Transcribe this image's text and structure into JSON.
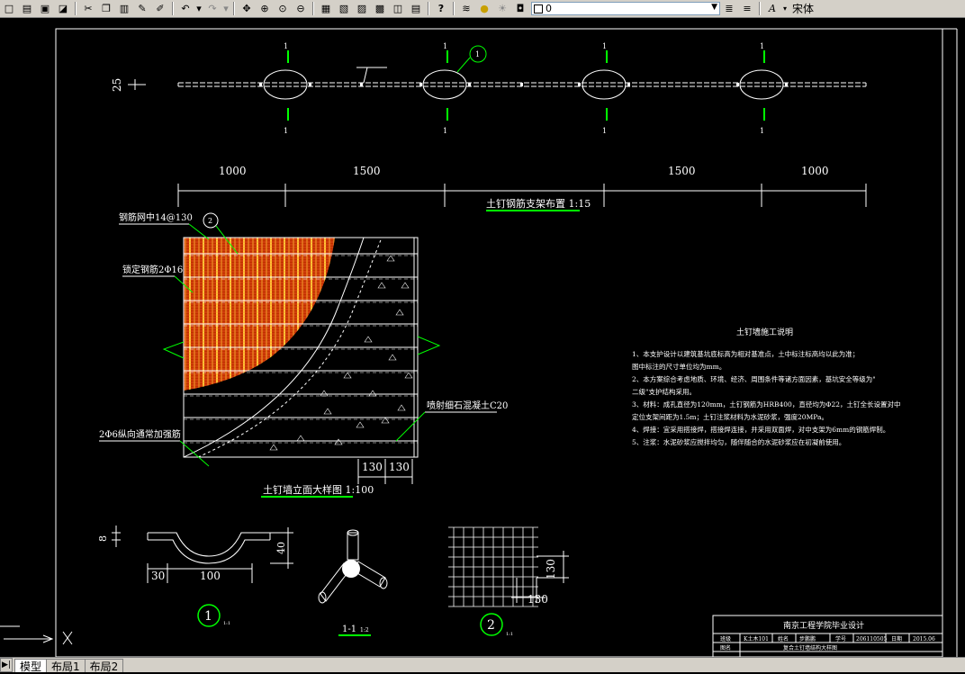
{
  "toolbar": {
    "layer_value": "0",
    "font_name": "宋体"
  },
  "drawing": {
    "plan": {
      "section_marks": [
        "1",
        "1",
        "1",
        "1",
        "1",
        "1",
        "1",
        "1"
      ],
      "detail_callout": "1",
      "left_dim": "25",
      "dims_left": [
        "1000",
        "1500"
      ],
      "dims_right": [
        "1500",
        "1000"
      ],
      "title": "土钉钢筋支架布置 1:15"
    },
    "elevation": {
      "label_mesh": "钢筋网中14@130",
      "label_fixed": "锁定钢筋2Φ16",
      "label_long": "2Φ6纵向通常加强筋",
      "label_shotcrete": "喷射细石混凝土C20",
      "detail_callout": "2",
      "dim_a": "130",
      "dim_b": "130",
      "title": "土钉墙立面大样图 1:100"
    },
    "notes": {
      "title": "土钉墙施工说明",
      "lines": [
        "1、本支护设计以建筑基坑底标高为相对基准点，土中标注标高均以此为准；",
        "图中标注的尺寸单位均为mm。",
        "2、本方案综合考虑地质、环境、经济、周围条件等诸方面因素，基坑安全等级为\"",
        "二级\"支护结构采用。",
        "3、材料：成孔直径为120mm，土钉钢筋为HRB400，直径均为Φ22，土钉全长设置对中",
        "定位支架间距为1.5m；土钉注浆材料为水泥砂浆，强度20MPa。",
        "4、焊接：宜采用搭接焊，搭接焊连接，并采用双面焊，对中支架为6mm的钢筋焊制。",
        "5、注浆：水泥砂浆应搅拌均匀，随伴随合的水泥砂浆应在初凝前使用。"
      ]
    },
    "detail1": {
      "dim_8": "8",
      "dim_30": "30",
      "dim_100": "100",
      "dim_40": "40",
      "number": "1",
      "scale": "1:1"
    },
    "section11": {
      "label": "1-1",
      "scale": "1:2"
    },
    "detail2": {
      "dim_130a": "130",
      "dim_130b": "130",
      "number": "2",
      "scale": "1:1"
    },
    "titleblock": {
      "title": "南京工程学院毕业设计",
      "r1c1": "班级",
      "r1c2": "K土木101",
      "r1c3": "姓名",
      "r1c4": "步鹏鹏",
      "r1c5": "学号",
      "r1c6": "206110505",
      "r1c7": "日期",
      "r1c8": "2015.06",
      "r2c1": "图名",
      "r2c2": "复合土钉墙结构大样图"
    }
  },
  "tabs": {
    "model": "模型",
    "layout1": "布局1",
    "layout2": "布局2"
  }
}
